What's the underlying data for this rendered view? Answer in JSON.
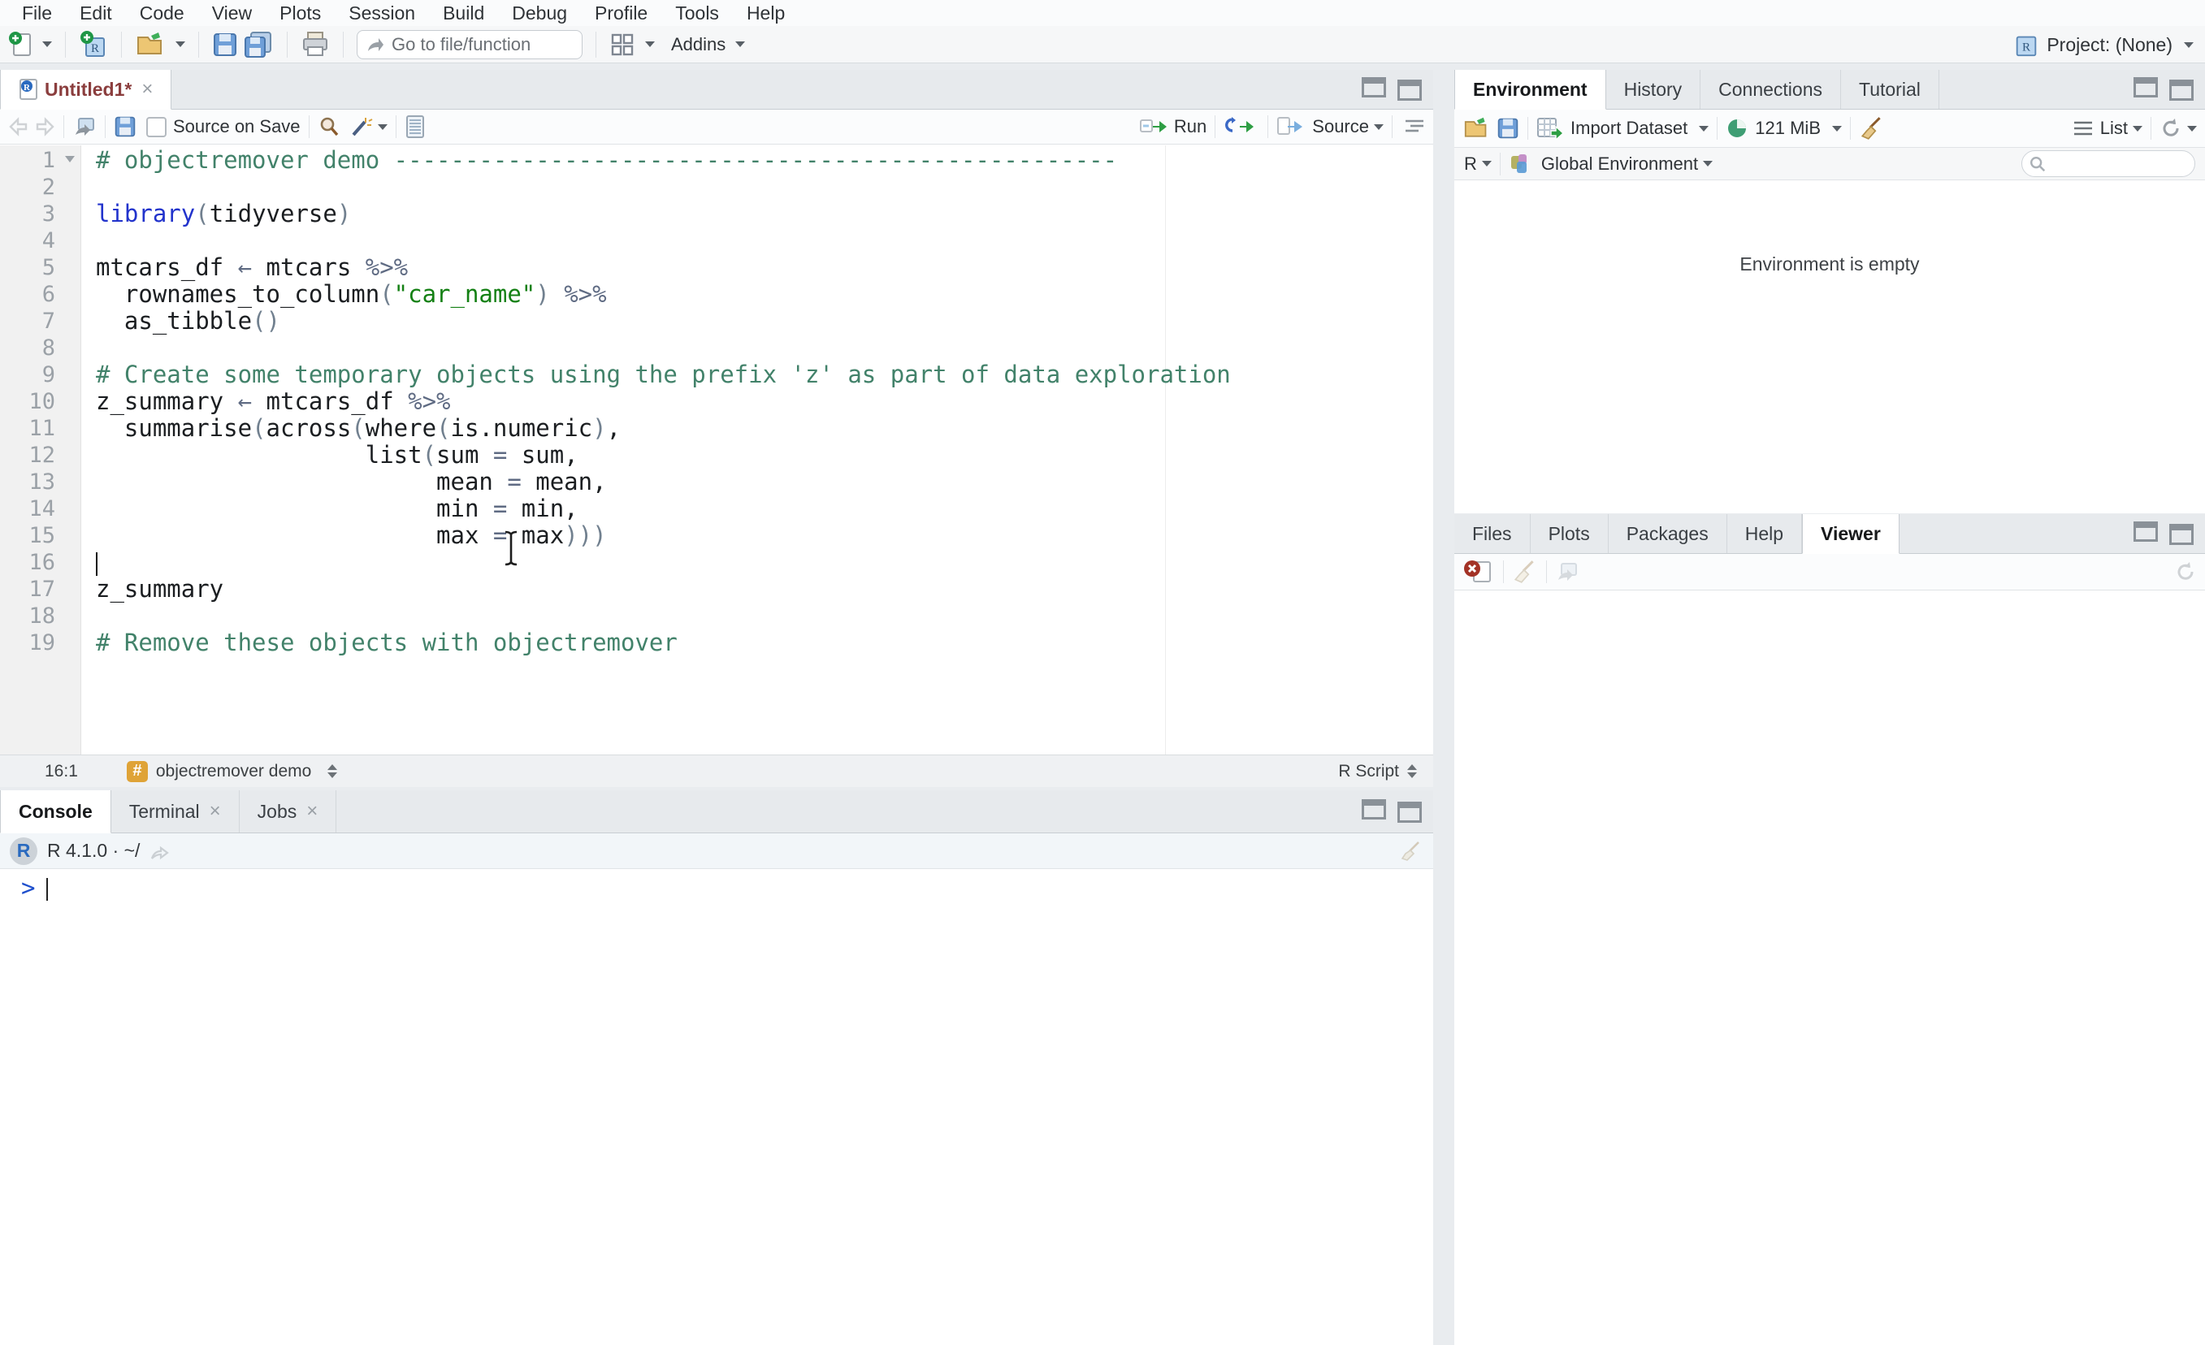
{
  "menubar": {
    "items": [
      "File",
      "Edit",
      "Code",
      "View",
      "Plots",
      "Session",
      "Build",
      "Debug",
      "Profile",
      "Tools",
      "Help"
    ]
  },
  "toolbar": {
    "goto_placeholder": "Go to file/function",
    "addins_label": "Addins",
    "project_label": "Project: (None)"
  },
  "editor": {
    "tab_title": "Untitled1*",
    "source_on_save": "Source on Save",
    "run_label": "Run",
    "source_label": "Source",
    "status": {
      "position": "16:1",
      "section": "objectremover demo",
      "file_type": "R Script"
    },
    "lines": [
      {
        "n": 1,
        "fold": true,
        "segs": [
          {
            "t": "# objectremover demo ---------------------------------------------------",
            "c": "comment"
          }
        ]
      },
      {
        "n": 2,
        "segs": []
      },
      {
        "n": 3,
        "segs": [
          {
            "t": "library",
            "c": "keyword"
          },
          {
            "t": "(",
            "c": "paren"
          },
          {
            "t": "tidyverse",
            "c": "normal"
          },
          {
            "t": ")",
            "c": "paren"
          }
        ]
      },
      {
        "n": 4,
        "segs": []
      },
      {
        "n": 5,
        "segs": [
          {
            "t": "mtcars_df ",
            "c": "normal"
          },
          {
            "t": "←",
            "c": "operator"
          },
          {
            "t": " mtcars ",
            "c": "normal"
          },
          {
            "t": "%>%",
            "c": "operator"
          }
        ]
      },
      {
        "n": 6,
        "segs": [
          {
            "t": "  rownames_to_column",
            "c": "normal"
          },
          {
            "t": "(",
            "c": "paren"
          },
          {
            "t": "\"car_name\"",
            "c": "string"
          },
          {
            "t": ")",
            "c": "paren"
          },
          {
            "t": " ",
            "c": "normal"
          },
          {
            "t": "%>%",
            "c": "operator"
          }
        ]
      },
      {
        "n": 7,
        "segs": [
          {
            "t": "  as_tibble",
            "c": "normal"
          },
          {
            "t": "()",
            "c": "paren"
          }
        ]
      },
      {
        "n": 8,
        "segs": []
      },
      {
        "n": 9,
        "segs": [
          {
            "t": "# Create some temporary objects using the prefix 'z' as part of data exploration",
            "c": "comment"
          }
        ]
      },
      {
        "n": 10,
        "segs": [
          {
            "t": "z_summary ",
            "c": "normal"
          },
          {
            "t": "←",
            "c": "operator"
          },
          {
            "t": " mtcars_df ",
            "c": "normal"
          },
          {
            "t": "%>%",
            "c": "operator"
          }
        ]
      },
      {
        "n": 11,
        "segs": [
          {
            "t": "  summarise",
            "c": "normal"
          },
          {
            "t": "(",
            "c": "paren"
          },
          {
            "t": "across",
            "c": "normal"
          },
          {
            "t": "(",
            "c": "paren"
          },
          {
            "t": "where",
            "c": "normal"
          },
          {
            "t": "(",
            "c": "paren"
          },
          {
            "t": "is.numeric",
            "c": "normal"
          },
          {
            "t": ")",
            "c": "paren"
          },
          {
            "t": ",",
            "c": "normal"
          }
        ]
      },
      {
        "n": 12,
        "segs": [
          {
            "t": "                   list",
            "c": "normal"
          },
          {
            "t": "(",
            "c": "paren"
          },
          {
            "t": "sum ",
            "c": "normal"
          },
          {
            "t": "=",
            "c": "operator"
          },
          {
            "t": " sum,",
            "c": "normal"
          }
        ]
      },
      {
        "n": 13,
        "segs": [
          {
            "t": "                        mean ",
            "c": "normal"
          },
          {
            "t": "=",
            "c": "operator"
          },
          {
            "t": " mean,",
            "c": "normal"
          }
        ]
      },
      {
        "n": 14,
        "segs": [
          {
            "t": "                        min ",
            "c": "normal"
          },
          {
            "t": "=",
            "c": "operator"
          },
          {
            "t": " min,",
            "c": "normal"
          }
        ]
      },
      {
        "n": 15,
        "segs": [
          {
            "t": "                        max ",
            "c": "normal"
          },
          {
            "t": "=",
            "c": "operator"
          },
          {
            "t": " max",
            "c": "normal"
          },
          {
            "t": ")))",
            "c": "paren"
          }
        ]
      },
      {
        "n": 16,
        "caret": true,
        "segs": []
      },
      {
        "n": 17,
        "segs": [
          {
            "t": "z_summary",
            "c": "normal"
          }
        ]
      },
      {
        "n": 18,
        "segs": []
      },
      {
        "n": 19,
        "segs": [
          {
            "t": "# Remove these objects with objectremover",
            "c": "comment"
          }
        ]
      }
    ]
  },
  "console": {
    "tabs": [
      {
        "label": "Console",
        "active": true
      },
      {
        "label": "Terminal",
        "closable": true
      },
      {
        "label": "Jobs",
        "closable": true
      }
    ],
    "header": "R 4.1.0 · ~/",
    "prompt": ">"
  },
  "environment": {
    "tabs": [
      {
        "label": "Environment",
        "active": true
      },
      {
        "label": "History"
      },
      {
        "label": "Connections"
      },
      {
        "label": "Tutorial"
      }
    ],
    "import_label": "Import Dataset",
    "memory_label": "121 MiB",
    "list_label": "List",
    "scope_r": "R",
    "scope_label": "Global Environment",
    "empty_message": "Environment is empty"
  },
  "files": {
    "tabs": [
      {
        "label": "Files"
      },
      {
        "label": "Plots"
      },
      {
        "label": "Packages"
      },
      {
        "label": "Help"
      },
      {
        "label": "Viewer",
        "active": true
      }
    ]
  },
  "colors": {
    "comment": "#42826a",
    "keyword": "#2233cc",
    "string": "#148014",
    "operator": "#5f6b83",
    "prompt": "#1e4fcc",
    "section_badge": "#dfa337",
    "run_green": "#2e9e44",
    "save_blue": "#5a8fd6"
  }
}
